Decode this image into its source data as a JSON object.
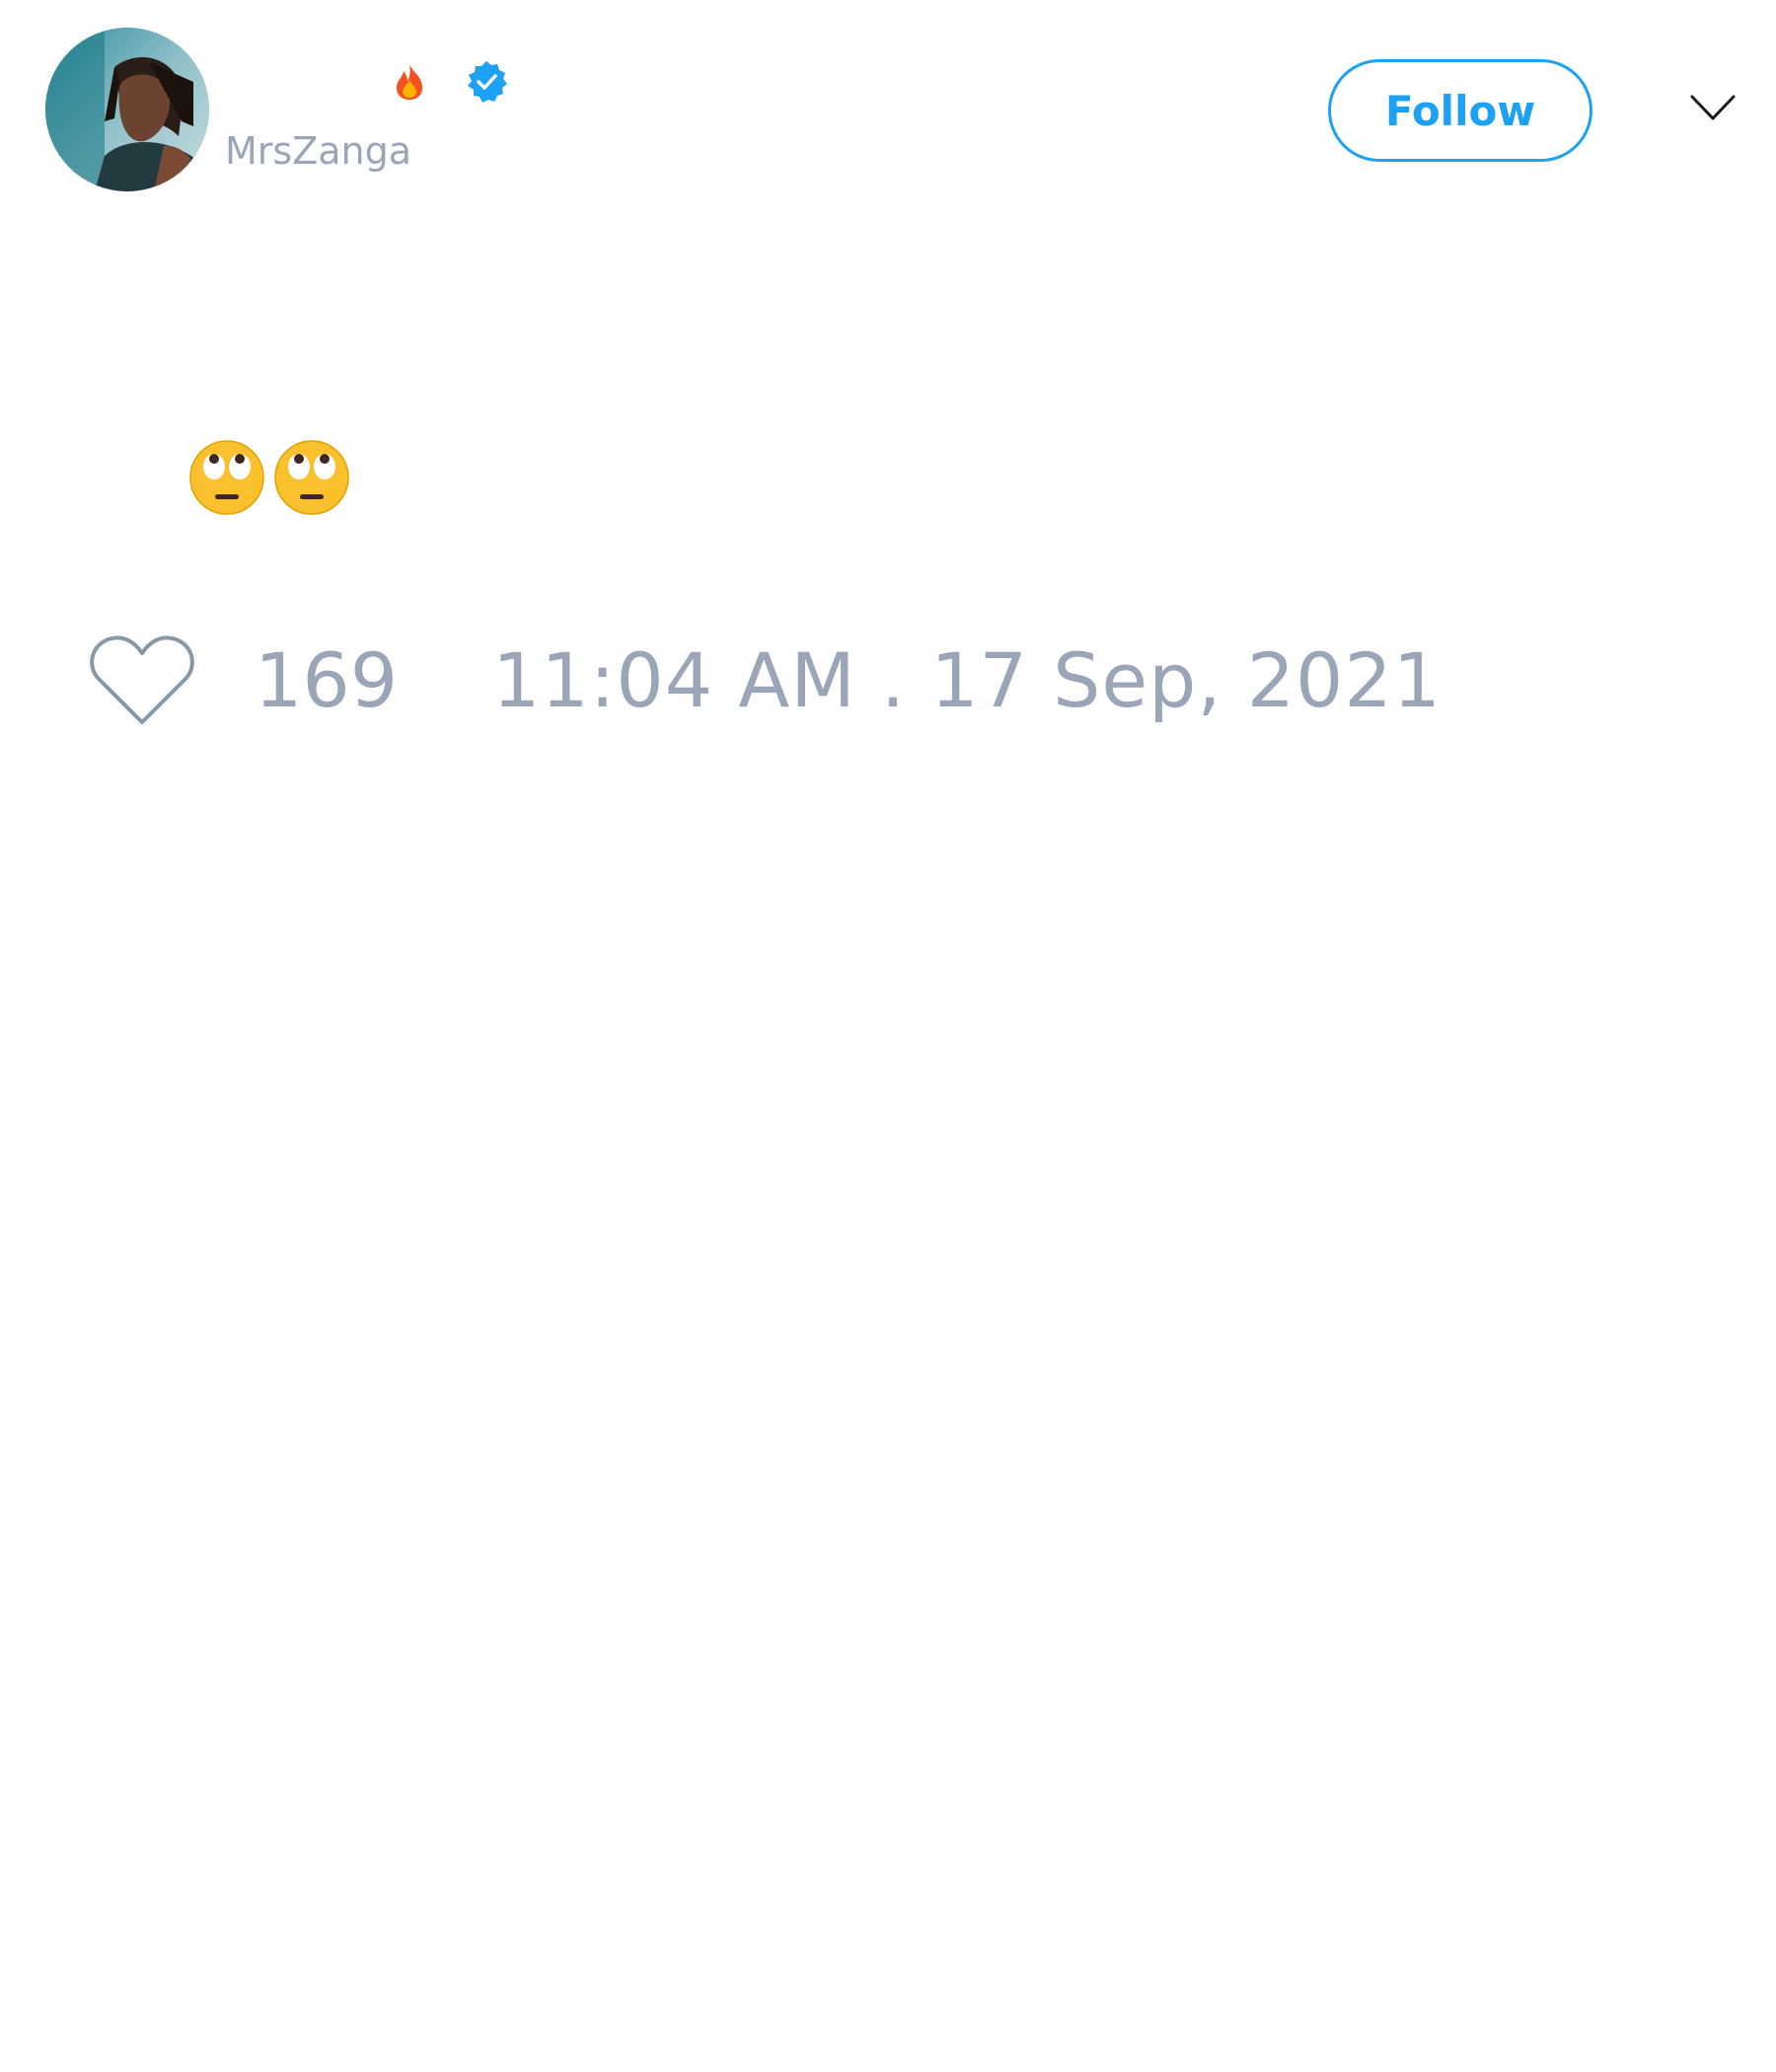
{
  "tweet": {
    "author": {
      "display_name": "",
      "username": "MrsZanga",
      "name_emoji_icon": "fire-icon",
      "verified_icon": "verified-badge-icon",
      "avatar": "profile-photo"
    },
    "follow_label": "Follow",
    "menu_icon": "chevron-down-icon",
    "body_emojis": [
      "face-with-rolling-eyes-icon",
      "face-with-rolling-eyes-icon"
    ],
    "like_icon": "heart-outline-icon",
    "like_count": "169",
    "timestamp": "11:04 AM . 17 Sep, 2021"
  },
  "colors": {
    "accent": "#1da1f2",
    "muted_text": "#9aa6b8",
    "background": "#ffffff"
  }
}
